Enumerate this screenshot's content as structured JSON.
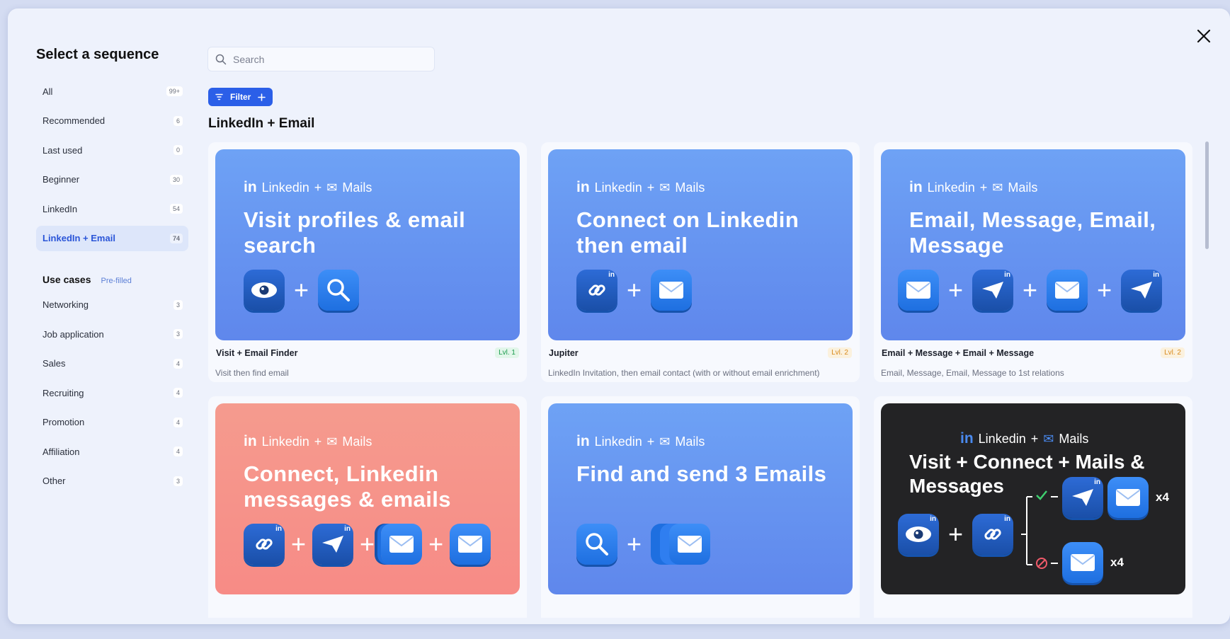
{
  "modal_title": "Select a sequence",
  "search": {
    "placeholder": "Search"
  },
  "filter_label": "Filter",
  "section_title": "LinkedIn + Email",
  "nav": [
    {
      "label": "All",
      "count": "99+"
    },
    {
      "label": "Recommended",
      "count": "6"
    },
    {
      "label": "Last used",
      "count": "0"
    },
    {
      "label": "Beginner",
      "count": "30"
    },
    {
      "label": "LinkedIn",
      "count": "54"
    },
    {
      "label": "LinkedIn + Email",
      "count": "74",
      "active": true
    }
  ],
  "use_cases": {
    "title": "Use cases",
    "badge": "Pre-filled",
    "items": [
      {
        "label": "Networking",
        "count": "3"
      },
      {
        "label": "Job application",
        "count": "3"
      },
      {
        "label": "Sales",
        "count": "4"
      },
      {
        "label": "Recruiting",
        "count": "4"
      },
      {
        "label": "Promotion",
        "count": "4"
      },
      {
        "label": "Affiliation",
        "count": "4"
      },
      {
        "label": "Other",
        "count": "3"
      }
    ]
  },
  "thumb_tag": {
    "in": "in",
    "linkedin": "Linkedin",
    "plus": "+",
    "mails": "Mails"
  },
  "cards": [
    {
      "thumb_title": "Visit profiles & email search",
      "name": "Visit + Email Finder",
      "level": "Lvl. 1",
      "desc": "Visit then find email"
    },
    {
      "thumb_title": "Connect on Linkedin then email",
      "name": "Jupiter",
      "level": "Lvl. 2",
      "desc": "LinkedIn Invitation, then email contact (with or without email enrichment)"
    },
    {
      "thumb_title": "Email, Message, Email, Message",
      "name": "Email + Message + Email + Message",
      "level": "Lvl. 2",
      "desc": "Email, Message, Email, Message to 1st relations"
    },
    {
      "thumb_title": "Connect, Linkedin messages & emails"
    },
    {
      "thumb_title": "Find and send 3 Emails"
    },
    {
      "thumb_title": "Visit + Connect + Mails & Messages",
      "multiplier_top": "x4",
      "multiplier_bottom": "x4"
    }
  ],
  "colors": {
    "accent": "#2b5fe8",
    "thumb_blue": "#6591f0",
    "thumb_salmon": "#f6938a",
    "thumb_dark": "#232325"
  }
}
